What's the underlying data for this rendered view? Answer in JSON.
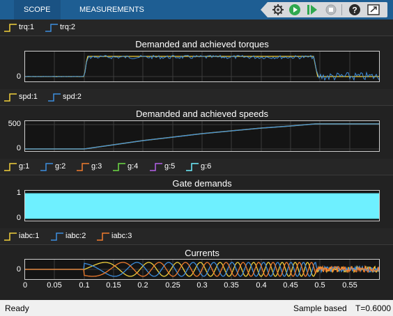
{
  "toolstrip": {
    "tabs": [
      {
        "label": "SCOPE",
        "active": true
      },
      {
        "label": "MEASUREMENTS",
        "active": false
      }
    ],
    "buttons": [
      "settings-icon",
      "run-icon",
      "step-forward-icon",
      "stop-icon",
      "help-icon",
      "undock-icon"
    ]
  },
  "plots": [
    {
      "title": "Demanded and achieved torques",
      "legend": [
        {
          "label": "trq:1",
          "color": "#f2d13c"
        },
        {
          "label": "trq:2",
          "color": "#3d8ede"
        }
      ],
      "yticks": [
        "0"
      ]
    },
    {
      "title": "Demanded and achieved speeds",
      "legend": [
        {
          "label": "spd:1",
          "color": "#f2d13c"
        },
        {
          "label": "spd:2",
          "color": "#3d8ede"
        }
      ],
      "yticks": [
        "500",
        "0"
      ]
    },
    {
      "title": "Gate demands",
      "legend": [
        {
          "label": "g:1",
          "color": "#f2d13c"
        },
        {
          "label": "g:2",
          "color": "#3d8ede"
        },
        {
          "label": "g:3",
          "color": "#f07c2e"
        },
        {
          "label": "g:4",
          "color": "#6ddb45"
        },
        {
          "label": "g:5",
          "color": "#b460e8"
        },
        {
          "label": "g:6",
          "color": "#6ef0ff"
        }
      ],
      "yticks": [
        "1",
        "0"
      ]
    },
    {
      "title": "Currents",
      "legend": [
        {
          "label": "iabc:1",
          "color": "#f2d13c"
        },
        {
          "label": "iabc:2",
          "color": "#3d8ede"
        },
        {
          "label": "iabc:3",
          "color": "#f07c2e"
        }
      ],
      "yticks": [
        "0"
      ]
    }
  ],
  "xaxis": {
    "ticks": [
      "0",
      "0.05",
      "0.1",
      "0.15",
      "0.2",
      "0.25",
      "0.3",
      "0.35",
      "0.4",
      "0.45",
      "0.5",
      "0.55"
    ]
  },
  "status": {
    "left": "Ready",
    "mode": "Sample based",
    "time": "T=0.6000"
  }
}
